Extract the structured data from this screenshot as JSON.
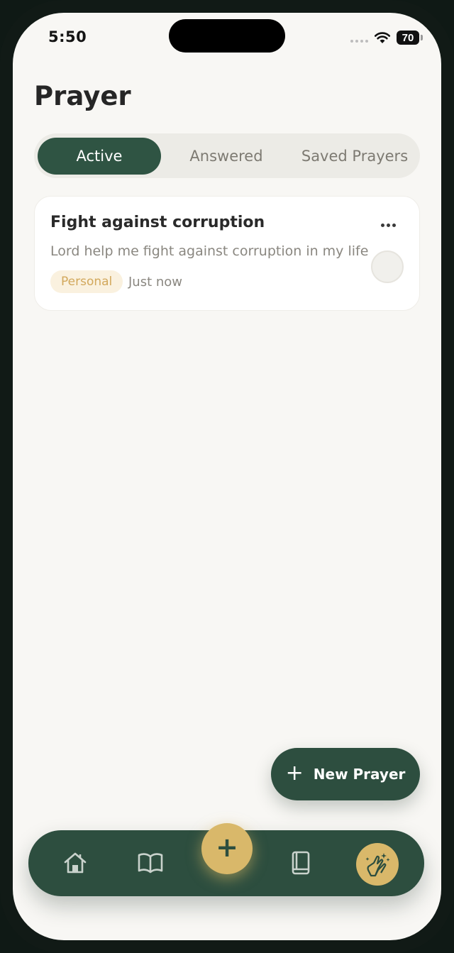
{
  "status_bar": {
    "time": "5:50",
    "battery": "70"
  },
  "header": {
    "title": "Prayer"
  },
  "tabs": [
    {
      "label": "Active",
      "selected": true
    },
    {
      "label": "Answered",
      "selected": false
    },
    {
      "label": "Saved Prayers",
      "selected": false
    }
  ],
  "prayers": [
    {
      "title": "Fight against corruption",
      "description": "Lord help me fight against corruption in my life",
      "tag": "Personal",
      "time": "Just now"
    }
  ],
  "fab": {
    "label": "New Prayer"
  },
  "bottom_nav": {
    "items": [
      {
        "icon": "home-icon"
      },
      {
        "icon": "open-book-icon"
      },
      {
        "icon": "plus-icon"
      },
      {
        "icon": "journal-icon"
      },
      {
        "icon": "praying-hands-icon",
        "selected": true
      }
    ]
  },
  "colors": {
    "primary": "#2d4e3f",
    "accent": "#d9b86a",
    "background": "#f8f7f4"
  }
}
